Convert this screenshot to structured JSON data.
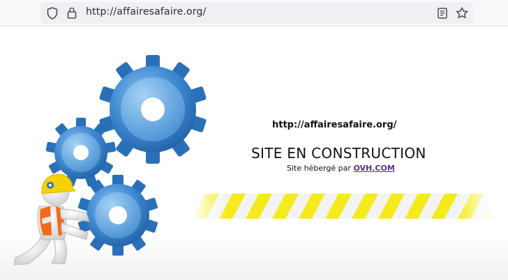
{
  "browser": {
    "url": "http://affairesafaire.org/",
    "icons": {
      "shield": "shield-icon",
      "lock": "lock-icon",
      "reader": "reader-view-icon",
      "bookmark": "star-bookmark-icon"
    }
  },
  "page": {
    "site_url": "http://affairesafaire.org/",
    "title": "SITE EN CONSTRUCTION",
    "hosted_prefix": "Site hébergé par ",
    "host_link": "OVH.COM"
  },
  "colors": {
    "gear_blue": "#2f79c0",
    "stripe_yellow": "#f4ea1c",
    "link_purple": "#5c2d91",
    "vest_orange": "#f26a1b",
    "helmet_yellow": "#f5d300"
  }
}
